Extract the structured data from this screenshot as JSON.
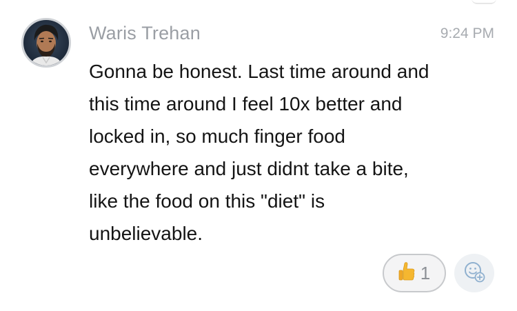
{
  "message": {
    "sender": "Waris Trehan",
    "timestamp": "9:24 PM",
    "lines": [
      "Gonna be honest. Last time around and",
      "this time around I feel 10x better and",
      "locked in, so much finger food",
      "everywhere and just didnt take a bite,",
      "like the food on this \"diet\" is",
      "unbelievable."
    ],
    "reactions": [
      {
        "icon": "thumbs-up-icon",
        "count": "1"
      }
    ],
    "add_reaction_icon": "add-emoji-icon"
  },
  "colors": {
    "sender": "#9a9ea4",
    "text": "#141414",
    "timestamp": "#a7abb0",
    "thumb": "#f5b730"
  }
}
